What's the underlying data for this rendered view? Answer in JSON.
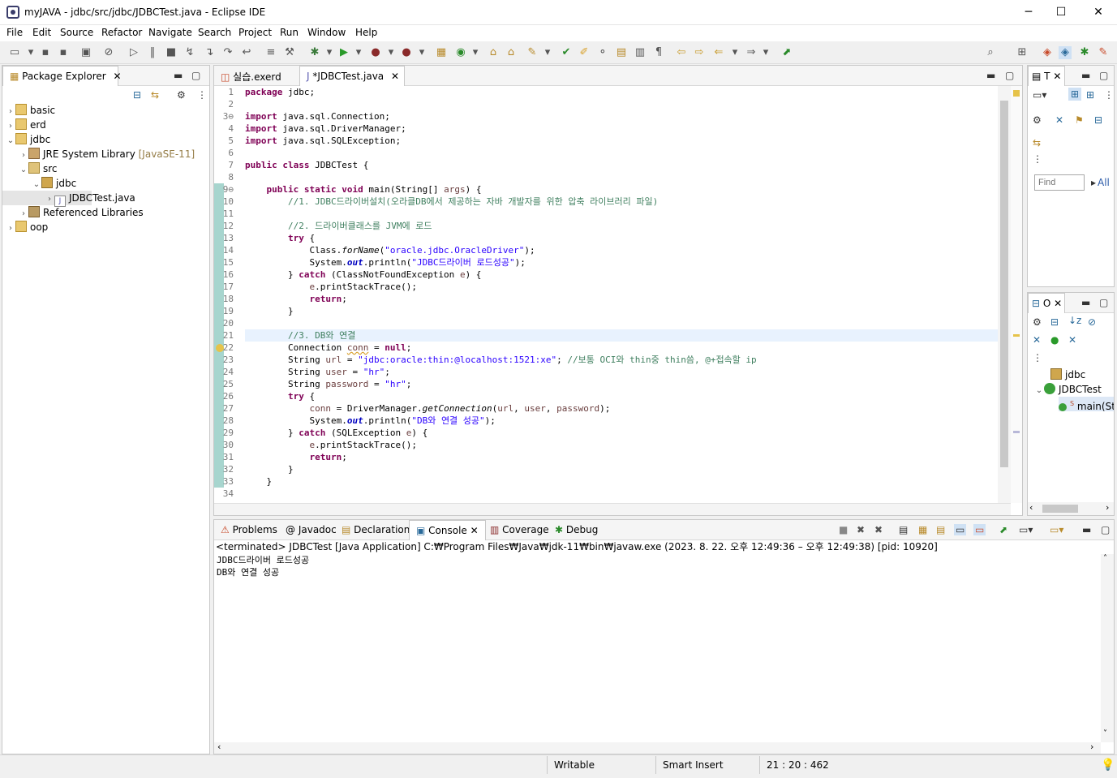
{
  "window": {
    "title": "myJAVA - jdbc/src/jdbc/JDBCTest.java - Eclipse IDE",
    "minimize": "─",
    "maximize": "☐",
    "close": "✕"
  },
  "menu": [
    "File",
    "Edit",
    "Source",
    "Refactor",
    "Navigate",
    "Search",
    "Project",
    "Run",
    "Window",
    "Help"
  ],
  "package_explorer": {
    "tab_label": "Package Explorer",
    "tree": [
      {
        "label": "basic",
        "icon": "project-icon"
      },
      {
        "label": "erd",
        "icon": "project-icon"
      },
      {
        "label": "jdbc",
        "icon": "project-icon"
      },
      {
        "label": "JRE System Library",
        "extra": "[JavaSE-11]",
        "icon": "library-icon"
      },
      {
        "label": "src",
        "icon": "source-folder-icon"
      },
      {
        "label": "jdbc",
        "icon": "package-icon"
      },
      {
        "label": "JDBCTest.java",
        "icon": "java-file-icon"
      },
      {
        "label": "Referenced Libraries",
        "icon": "library-icon"
      },
      {
        "label": "oop",
        "icon": "project-icon"
      }
    ]
  },
  "editor": {
    "tabs": [
      {
        "label": "실습.exerd"
      },
      {
        "label": "*JDBCTest.java"
      }
    ],
    "line_numbers": [
      "1",
      "2",
      "3⊖",
      "4",
      "5",
      "6",
      "7",
      "8",
      "9⊖",
      "10",
      "11",
      "12",
      "13",
      "14",
      "15",
      "16",
      "17",
      "18",
      "19",
      "20",
      "21",
      "22",
      "23",
      "24",
      "25",
      "26",
      "27",
      "28",
      "29",
      "30",
      "31",
      "32",
      "33",
      "34"
    ],
    "code": {
      "l1a": "package",
      "l1b": " jdbc;",
      "l3a": "import",
      "l3b": " java.sql.Connection;",
      "l4a": "import",
      "l4b": " java.sql.DriverManager;",
      "l5a": "import",
      "l5b": " java.sql.SQLException;",
      "l7a": "public",
      "l7b": " ",
      "l7c": "class",
      "l7d": " JDBCTest {",
      "l9a": "    ",
      "l9b": "public",
      "l9c": " ",
      "l9d": "static",
      "l9e": " ",
      "l9f": "void",
      "l9g": " main(String[] ",
      "l9h": "args",
      "l9i": ") {",
      "l10": "        //1. JDBC드라이버설치(오라클DB에서 제공하는 자바 개발자를 위한 압축 라이브러리 파일)",
      "l12": "        //2. 드라이버클래스를 JVM에 로드",
      "l13a": "        ",
      "l13b": "try",
      "l13c": " {",
      "l14a": "            Class.",
      "l14b": "forName",
      "l14c": "(",
      "l14d": "\"oracle.jdbc.OracleDriver\"",
      "l14e": ");",
      "l15a": "            System.",
      "l15b": "out",
      "l15c": ".println(",
      "l15d": "\"JDBC드라이버 로드성공\"",
      "l15e": ");",
      "l16a": "        } ",
      "l16b": "catch",
      "l16c": " (ClassNotFoundException ",
      "l16d": "e",
      "l16e": ") {",
      "l17a": "            ",
      "l17b": "e",
      "l17c": ".printStackTrace();",
      "l18a": "            ",
      "l18b": "return",
      "l18c": ";",
      "l19": "        }",
      "l21": "        //3. DB와 연결",
      "l22a": "        Connection ",
      "l22b": "conn",
      "l22c": " = ",
      "l22d": "null",
      "l22e": ";",
      "l23a": "        String ",
      "l23b": "url",
      "l23c": " = ",
      "l23d": "\"jdbc:oracle:thin:@localhost:1521:xe\"",
      "l23e": "; ",
      "l23f": "//보통 OCI와 thin중 thin씀, @+접속할 ip",
      "l24a": "        String ",
      "l24b": "user",
      "l24c": " = ",
      "l24d": "\"hr\"",
      "l24e": ";",
      "l25a": "        String ",
      "l25b": "password",
      "l25c": " = ",
      "l25d": "\"hr\"",
      "l25e": ";",
      "l26a": "        ",
      "l26b": "try",
      "l26c": " {",
      "l27a": "            ",
      "l27b": "conn",
      "l27c": " = DriverManager.",
      "l27d": "getConnection",
      "l27e": "(",
      "l27f": "url",
      "l27g": ", ",
      "l27h": "user",
      "l27i": ", ",
      "l27j": "password",
      "l27k": ");",
      "l28a": "            System.",
      "l28b": "out",
      "l28c": ".println(",
      "l28d": "\"DB와 연결 성공\"",
      "l28e": ");",
      "l29a": "        } ",
      "l29b": "catch",
      "l29c": " (SQLException ",
      "l29d": "e",
      "l29e": ") {",
      "l30a": "            ",
      "l30b": "e",
      "l30c": ".printStackTrace();",
      "l31a": "            ",
      "l31b": "return",
      "l31c": ";",
      "l32": "        }",
      "l33": "    }"
    }
  },
  "task_view": {
    "tab_label": "T",
    "find_placeholder": "Find",
    "all_label": "All"
  },
  "outline": {
    "tab_label": "O",
    "items": [
      {
        "label": "jdbc"
      },
      {
        "label": "JDBCTest"
      },
      {
        "label": "main(St",
        "prefix": "S"
      }
    ]
  },
  "bottom_tabs": [
    {
      "label": "Problems"
    },
    {
      "label": "Javadoc"
    },
    {
      "label": "Declaration"
    },
    {
      "label": "Console"
    },
    {
      "label": "Coverage"
    },
    {
      "label": "Debug"
    }
  ],
  "console": {
    "header": "<terminated> JDBCTest [Java Application] C:₩Program Files₩Java₩jdk-11₩bin₩javaw.exe  (2023. 8. 22. 오후 12:49:36 – 오후 12:49:38) [pid: 10920]",
    "lines": [
      "JDBC드라이버 로드성공",
      "DB와 연결 성공"
    ]
  },
  "status": {
    "writable": "Writable",
    "insert_mode": "Smart Insert",
    "position": "21 : 20 : 462"
  }
}
